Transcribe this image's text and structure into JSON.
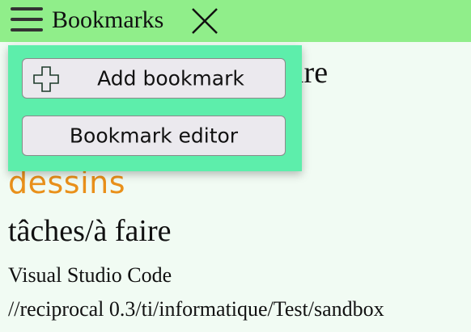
{
  "header": {
    "title": "Bookmarks",
    "menu_icon": "hamburger-menu-icon",
    "close_icon": "close-icon"
  },
  "list": {
    "item_1_partial": "ire",
    "item_dessins": "dessins",
    "item_taches": "tâches/à faire",
    "item_vscode": "Visual Studio Code",
    "item_path": "//reciprocal 0.3/ti/informatique/Test/sandbox"
  },
  "dropdown": {
    "add_label": "Add bookmark",
    "add_icon": "plus-icon",
    "editor_label": "Bookmark editor"
  },
  "colors": {
    "topbar": "#90ee8a",
    "dropdown": "#5deeab",
    "background": "#f1fbf3",
    "accent_text": "#e9901a"
  }
}
